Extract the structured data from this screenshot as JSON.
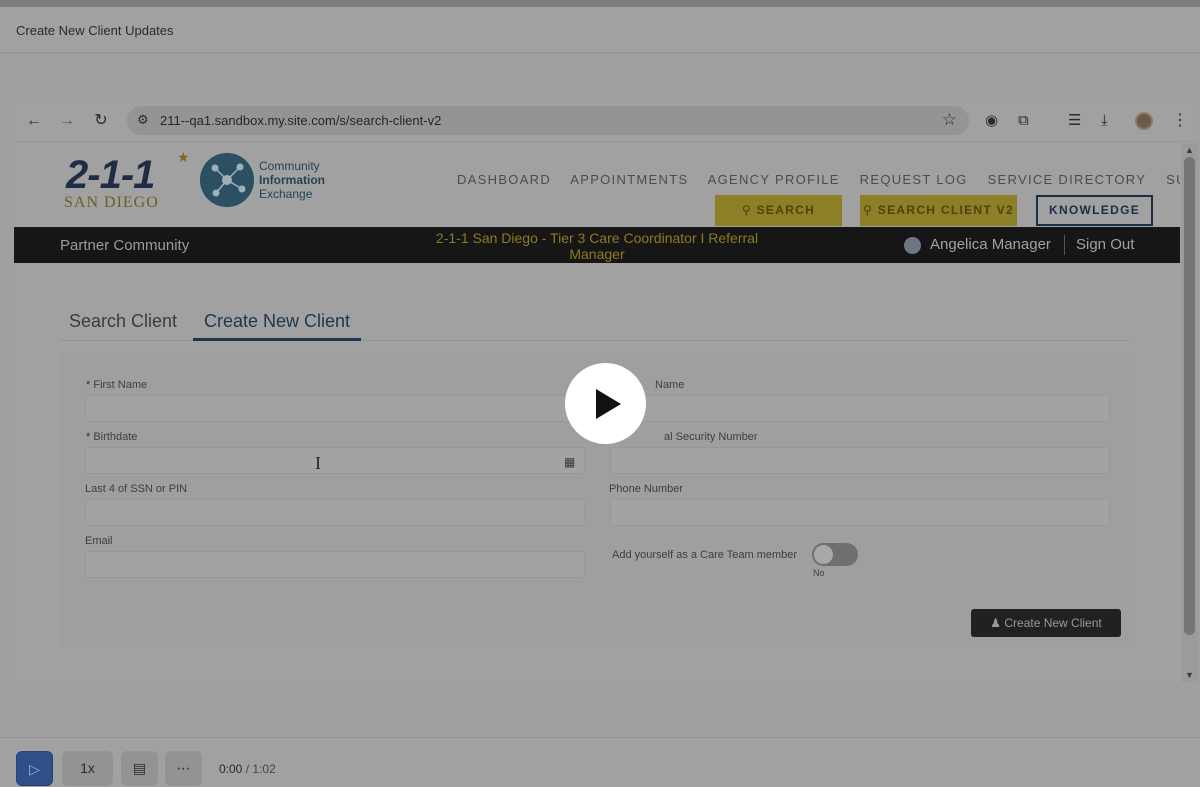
{
  "window": {
    "title": "Create New Client Updates"
  },
  "browser": {
    "url": "211--qa1.sandbox.my.site.com/s/search-client-v2",
    "icons": [
      "back-icon",
      "forward-icon",
      "reload-icon",
      "site-settings-icon",
      "star-icon",
      "extension-icon",
      "puzzle-icon",
      "media-queue-icon",
      "download-icon",
      "profile-avatar",
      "more-vert-icon"
    ]
  },
  "site": {
    "logo": {
      "digits": "2-1-1",
      "region": "SAN DIEGO"
    },
    "cie_logo": {
      "line1": "Community",
      "line2": "Information",
      "line3": "Exchange"
    },
    "nav": [
      "DASHBOARD",
      "APPOINTMENTS",
      "AGENCY PROFILE",
      "REQUEST LOG",
      "SERVICE DIRECTORY",
      "SUPPORT"
    ],
    "search_client": "SEARCH CLIENT",
    "search_client_v2": "SEARCH CLIENT V2",
    "knowledge": "KNOWLEDGE",
    "community": "Partner Community",
    "role_line1": "2-1-1 San Diego - Tier 3 Care Coordinator I Referral",
    "role_line2": "Manager",
    "user_name": "Angelica Manager",
    "sign_out": "Sign Out",
    "accent_color": "#fdd000",
    "dark_color": "#161616"
  },
  "tabs": [
    "Search Client",
    "Create New Client"
  ],
  "form": {
    "first_name": "First Name",
    "last_name": "Name",
    "birthdate": "Birthdate",
    "ssn": "al Security Number",
    "last4": "Last 4 of SSN or PIN",
    "phone": "Phone Number",
    "email": "Email",
    "care_team": "Add yourself as a Care Team member",
    "toggle_state": "No",
    "create_button": "Create New Client",
    "required_mark": "*"
  },
  "player": {
    "speed": "1x",
    "current_time": "0:00",
    "separator": "/",
    "duration": "1:02"
  }
}
